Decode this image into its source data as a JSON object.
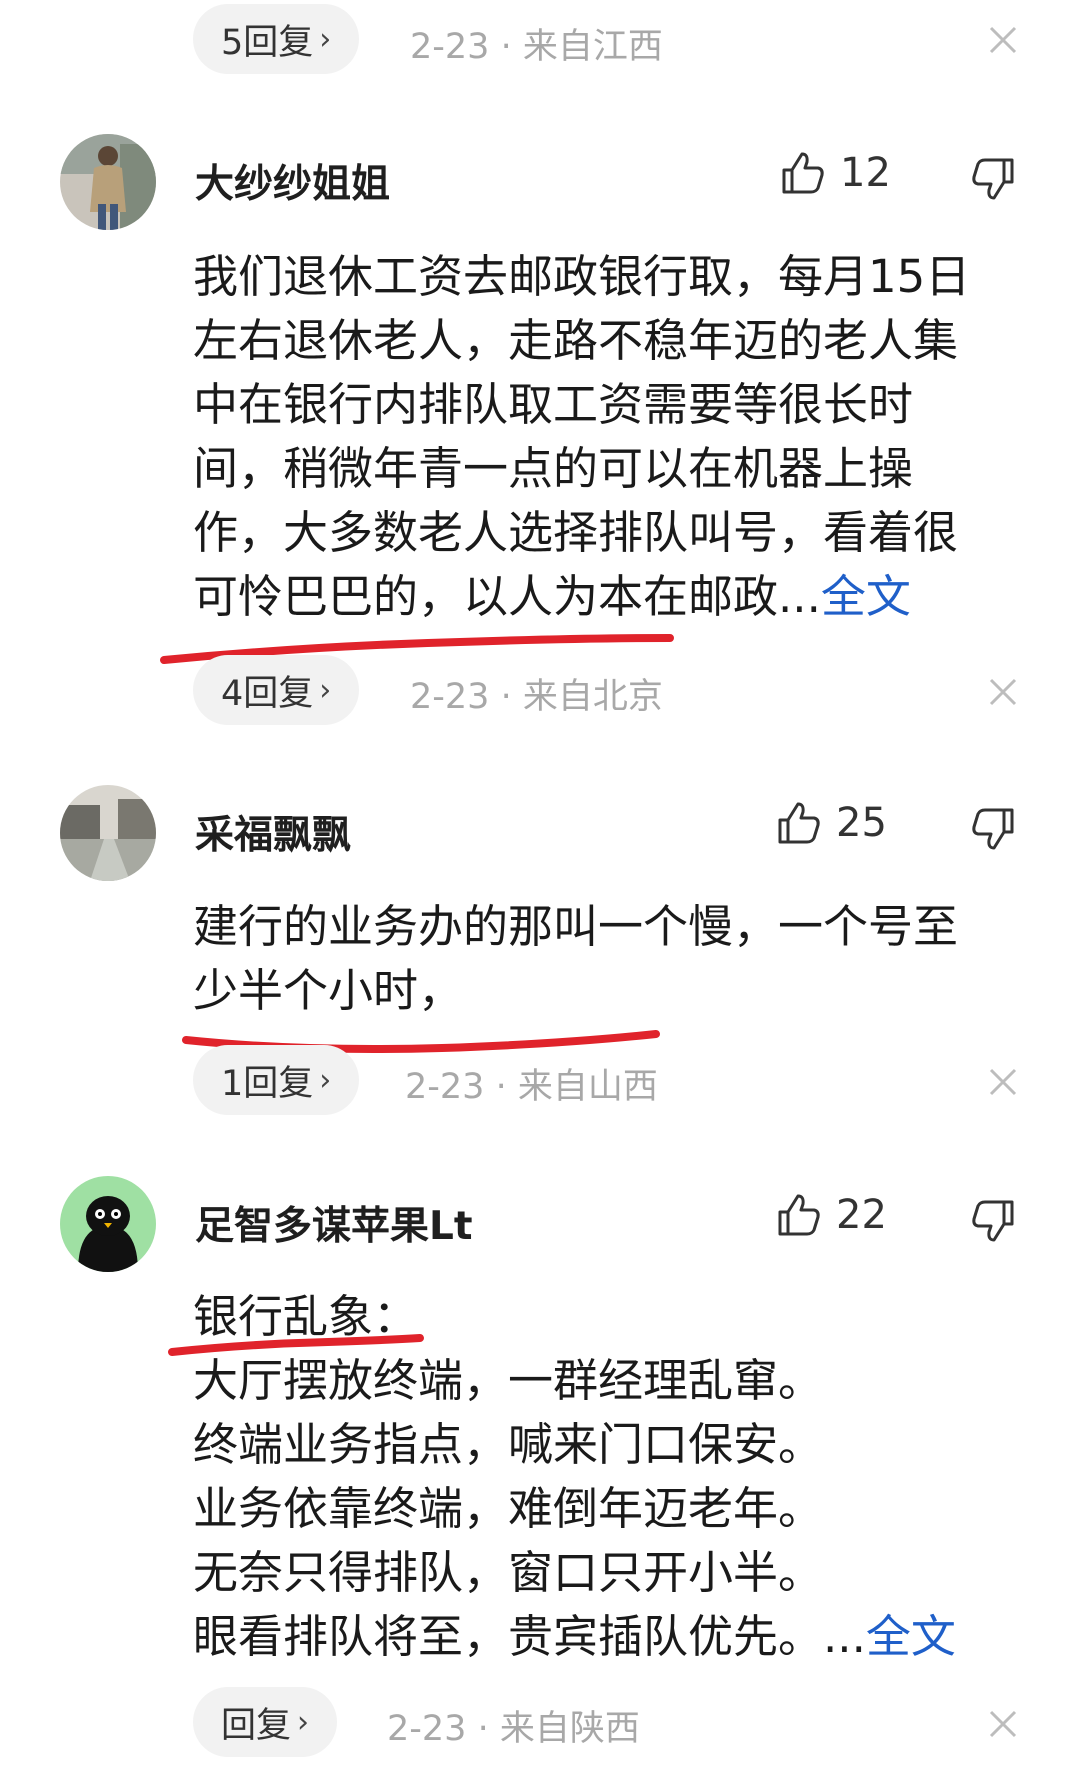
{
  "top": {
    "reply_label": "5回复",
    "date": "2-23",
    "location": "来自江西"
  },
  "comments": [
    {
      "username": "大纱纱姐姐",
      "likes": "12",
      "body_lines": [
        "我们退休工资去邮政银行取，每月15日",
        "左右退休老人，走路不稳年迈的老人集",
        "中在银行内排队取工资需要等很长时",
        "间，稍微年青一点的可以在机器上操",
        "作，大多数老人选择排队叫号，看着很",
        "可怜巴巴的，以人为本在邮政..."
      ],
      "more_label": "全文",
      "reply_label": "4回复",
      "date": "2-23",
      "location": "来自北京"
    },
    {
      "username": "采福飘飘",
      "likes": "25",
      "body_lines": [
        "建行的业务办的那叫一个慢，一个号至",
        "少半个小时，"
      ],
      "reply_label": "1回复",
      "date": "2-23",
      "location": "来自山西"
    },
    {
      "username": "足智多谋苹果Lt",
      "likes": "22",
      "body_lines": [
        "银行乱象：",
        "大厅摆放终端，一群经理乱窜。",
        "终端业务指点，喊来门口保安。",
        "业务依靠终端，难倒年迈老年。",
        "无奈只得排队，窗口只开小半。",
        "眼看排队将至，贵宾插队优先。..."
      ],
      "more_label": "全文",
      "reply_label": "回复",
      "date": "2-23",
      "location": "来自陕西"
    }
  ],
  "colors": {
    "link": "#1f5fc9",
    "underline": "#e0232b",
    "meta": "#a8a8a8",
    "pill": "#f2f2f2"
  },
  "separator": "·"
}
